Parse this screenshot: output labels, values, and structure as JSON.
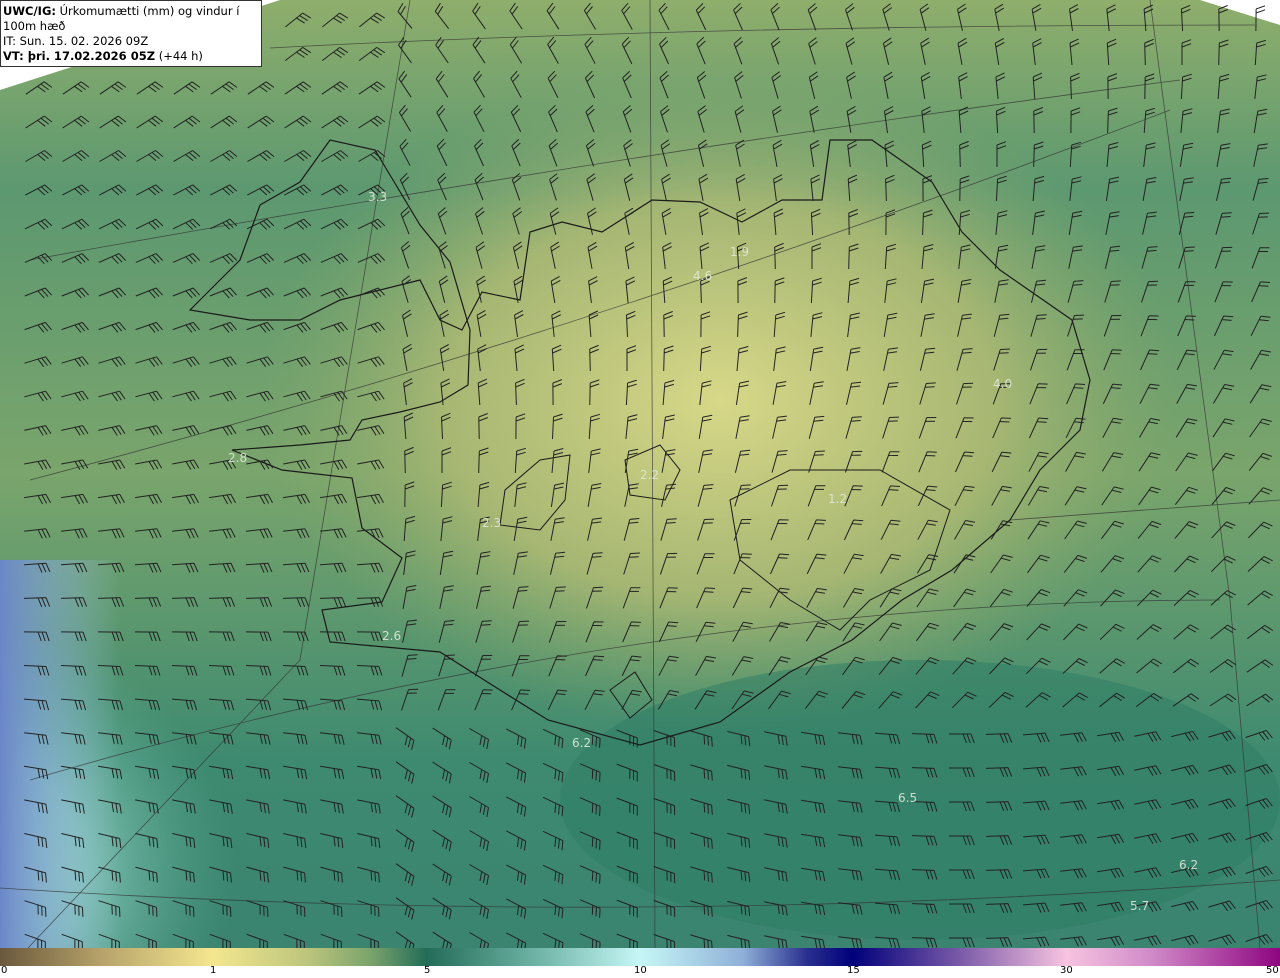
{
  "header": {
    "model": "UWC/IG:",
    "description": "Úrkomumætti (mm) og vindur í 100m hæð",
    "initial_time": "IT: Sun. 15. 02. 2026 09Z",
    "valid_prefix": "VT: þri. 17.02.2026 05Z",
    "lead_time": "(+44 h)"
  },
  "map_labels": [
    "3.3",
    "4.6",
    "1.9",
    "4.0",
    "2.8",
    "2.2",
    "2.3",
    "1.2",
    "2.6",
    "6.2",
    "6.5",
    "6.2",
    "5.7"
  ],
  "colorbar": {
    "ticks": [
      "0",
      "1",
      "5",
      "10",
      "15",
      "30",
      "50"
    ],
    "colors": [
      "#6a583c",
      "#f4e78f",
      "#236c58",
      "#c6f7f6",
      "#00007a",
      "#f7c4e0",
      "#8e0580"
    ]
  }
}
